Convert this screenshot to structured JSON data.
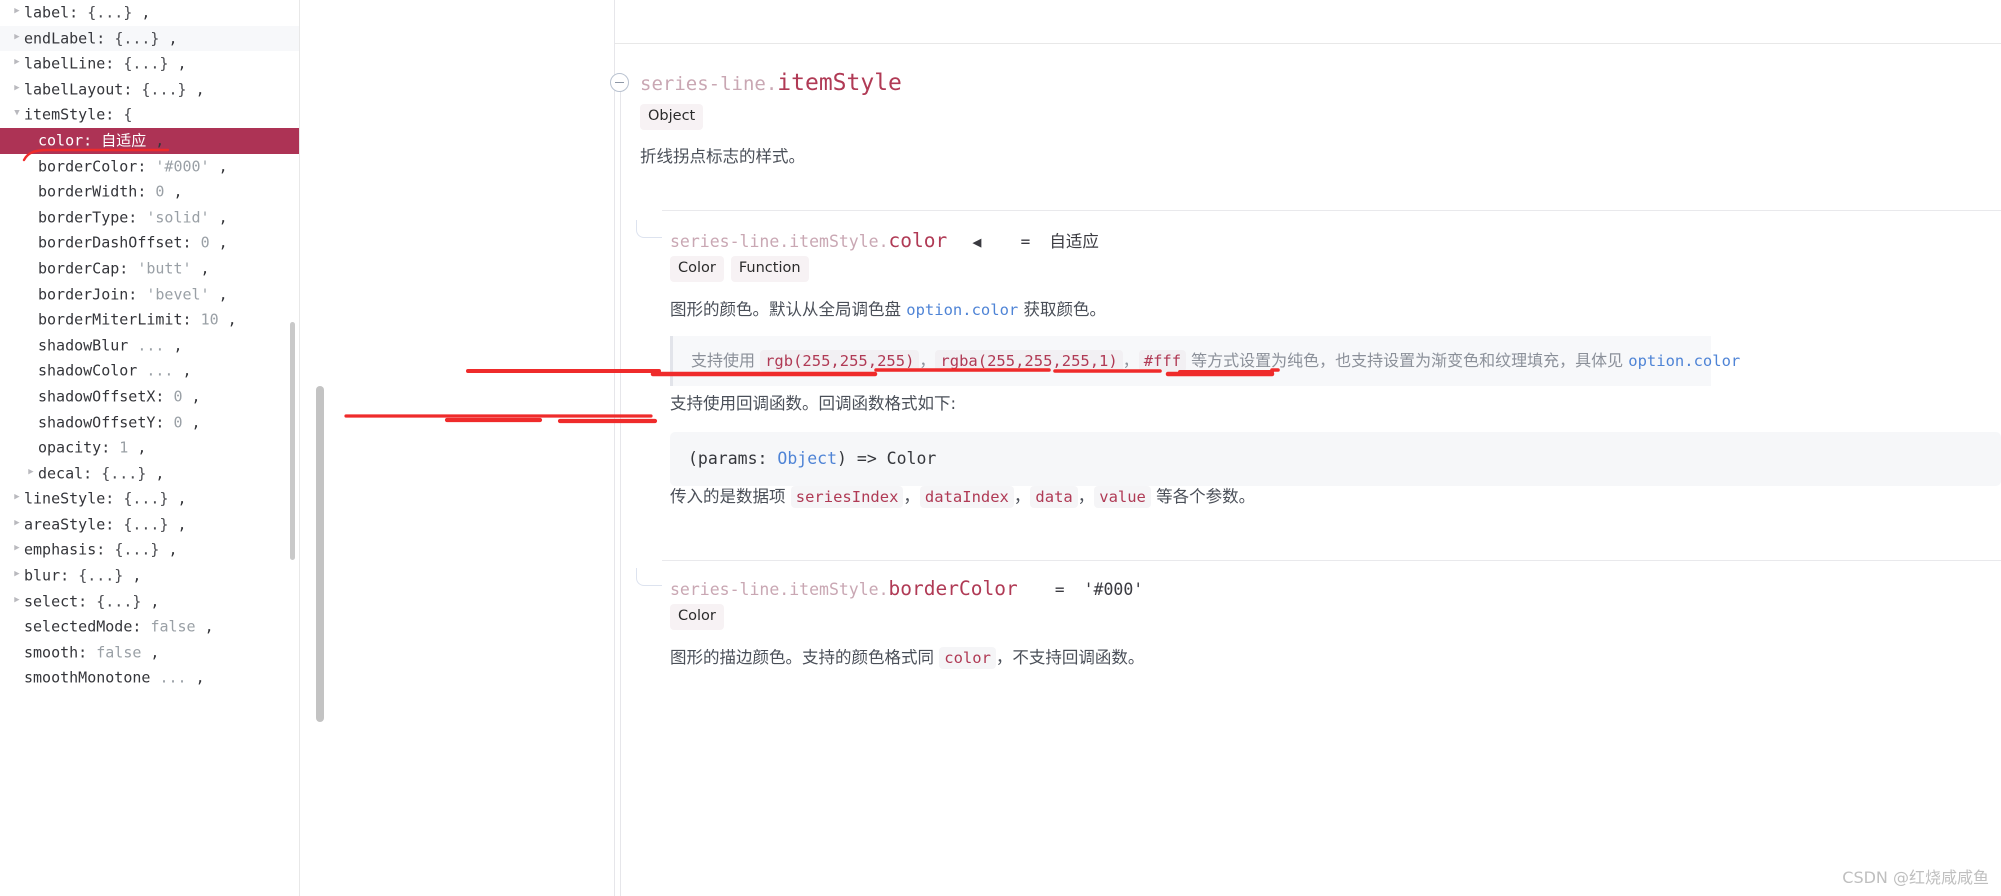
{
  "sidebar": {
    "rows": [
      {
        "indent": 1,
        "arrow": "closed",
        "key": "label",
        "value": "{...}",
        "kind": "object",
        "alt": false,
        "selected": false
      },
      {
        "indent": 1,
        "arrow": "closed",
        "key": "endLabel",
        "value": "{...}",
        "kind": "object",
        "alt": true,
        "selected": false
      },
      {
        "indent": 1,
        "arrow": "closed",
        "key": "labelLine",
        "value": "{...}",
        "kind": "object",
        "alt": false,
        "selected": false
      },
      {
        "indent": 1,
        "arrow": "closed",
        "key": "labelLayout",
        "value": "{...}",
        "kind": "object",
        "alt": false,
        "selected": false
      },
      {
        "indent": 1,
        "arrow": "open",
        "key": "itemStyle",
        "value": "{",
        "kind": "open",
        "alt": false,
        "selected": false
      },
      {
        "indent": 2,
        "arrow": "none",
        "key": "color",
        "value": "自适应",
        "kind": "adapt",
        "alt": false,
        "selected": true
      },
      {
        "indent": 2,
        "arrow": "none",
        "key": "borderColor",
        "value": "'#000'",
        "kind": "string",
        "alt": false,
        "selected": false
      },
      {
        "indent": 2,
        "arrow": "none",
        "key": "borderWidth",
        "value": "0",
        "kind": "number",
        "alt": false,
        "selected": false
      },
      {
        "indent": 2,
        "arrow": "none",
        "key": "borderType",
        "value": "'solid'",
        "kind": "string",
        "alt": false,
        "selected": false
      },
      {
        "indent": 2,
        "arrow": "none",
        "key": "borderDashOffset",
        "value": "0",
        "kind": "number",
        "alt": false,
        "selected": false
      },
      {
        "indent": 2,
        "arrow": "none",
        "key": "borderCap",
        "value": "'butt'",
        "kind": "string",
        "alt": false,
        "selected": false
      },
      {
        "indent": 2,
        "arrow": "none",
        "key": "borderJoin",
        "value": "'bevel'",
        "kind": "string",
        "alt": false,
        "selected": false
      },
      {
        "indent": 2,
        "arrow": "none",
        "key": "borderMiterLimit",
        "value": "10",
        "kind": "number",
        "alt": false,
        "selected": false
      },
      {
        "indent": 2,
        "arrow": "none",
        "key": "shadowBlur",
        "value": "...",
        "kind": "dots",
        "alt": false,
        "selected": false
      },
      {
        "indent": 2,
        "arrow": "none",
        "key": "shadowColor",
        "value": "...",
        "kind": "dots",
        "alt": false,
        "selected": false
      },
      {
        "indent": 2,
        "arrow": "none",
        "key": "shadowOffsetX",
        "value": "0",
        "kind": "number",
        "alt": false,
        "selected": false
      },
      {
        "indent": 2,
        "arrow": "none",
        "key": "shadowOffsetY",
        "value": "0",
        "kind": "number",
        "alt": false,
        "selected": false
      },
      {
        "indent": 2,
        "arrow": "none",
        "key": "opacity",
        "value": "1",
        "kind": "number",
        "alt": false,
        "selected": false
      },
      {
        "indent": 2,
        "arrow": "closed",
        "key": "decal",
        "value": "{...}",
        "kind": "object",
        "alt": false,
        "selected": false
      },
      {
        "indent": 1,
        "arrow": "closed",
        "key": "lineStyle",
        "value": "{...}",
        "kind": "object",
        "alt": false,
        "selected": false
      },
      {
        "indent": 1,
        "arrow": "closed",
        "key": "areaStyle",
        "value": "{...}",
        "kind": "object",
        "alt": false,
        "selected": false
      },
      {
        "indent": 1,
        "arrow": "closed",
        "key": "emphasis",
        "value": "{...}",
        "kind": "object",
        "alt": false,
        "selected": false
      },
      {
        "indent": 1,
        "arrow": "closed",
        "key": "blur",
        "value": "{...}",
        "kind": "object",
        "alt": false,
        "selected": false
      },
      {
        "indent": 1,
        "arrow": "closed",
        "key": "select",
        "value": "{...}",
        "kind": "object",
        "alt": false,
        "selected": false
      },
      {
        "indent": 1,
        "arrow": "none",
        "key": "selectedMode",
        "value": "false",
        "kind": "bool",
        "alt": false,
        "selected": false
      },
      {
        "indent": 1,
        "arrow": "none",
        "key": "smooth",
        "value": "false",
        "kind": "bool",
        "alt": false,
        "selected": false
      },
      {
        "indent": 1,
        "arrow": "none",
        "key": "smoothMonotone",
        "value": "...",
        "kind": "dots",
        "alt": false,
        "selected": false
      }
    ]
  },
  "doc": {
    "section_itemStyle": {
      "prefix": "series-line.",
      "name": "itemStyle",
      "tags": [
        "Object"
      ],
      "description": "折线拐点标志的样式。"
    },
    "prop_color": {
      "prefix": "series-line.itemStyle.",
      "name": "color",
      "back_caret": "◀",
      "equals": "=",
      "value": "自适应",
      "tags": [
        "Color",
        "Function"
      ],
      "desc_part1": "图形的颜色。默认从全局调色盘 ",
      "desc_code": "option.color",
      "desc_part2": " 获取颜色。",
      "callout_pre": "支持使用 ",
      "callout_code1": "rgb(255,255,255)",
      "callout_sep1": "，",
      "callout_code2": "rgba(255,255,255,1)",
      "callout_sep2": "，",
      "callout_code3": "#fff",
      "callout_mid": " 等方式设置为纯色，也支持设置为渐变色和纹理填充，具体见 ",
      "callout_link": "option.color",
      "callback_text": "支持使用回调函数。回调函数格式如下:",
      "code_block_pre": "(params: ",
      "code_block_type": "Object",
      "code_block_post": ") => Color",
      "params_pre": "传入的是数据项 ",
      "params_list": [
        "seriesIndex",
        "dataIndex",
        "data",
        "value"
      ],
      "params_post": " 等各个参数。"
    },
    "prop_borderColor": {
      "prefix": "series-line.itemStyle.",
      "name": "borderColor",
      "equals": "=",
      "value": "'#000'",
      "tags": [
        "Color"
      ],
      "desc_part1": "图形的描边颜色。支持的颜色格式同 ",
      "desc_code": "color",
      "desc_part2": "，不支持回调函数。"
    }
  },
  "watermark": "CSDN @红烧咸咸鱼",
  "colors": {
    "selected_row_bg": "#ad3355",
    "accent": "#b03a55",
    "ink_red": "#ef2b2b",
    "tag_bg": "#f7f2f4",
    "callout_bg": "#f7f8fa"
  }
}
